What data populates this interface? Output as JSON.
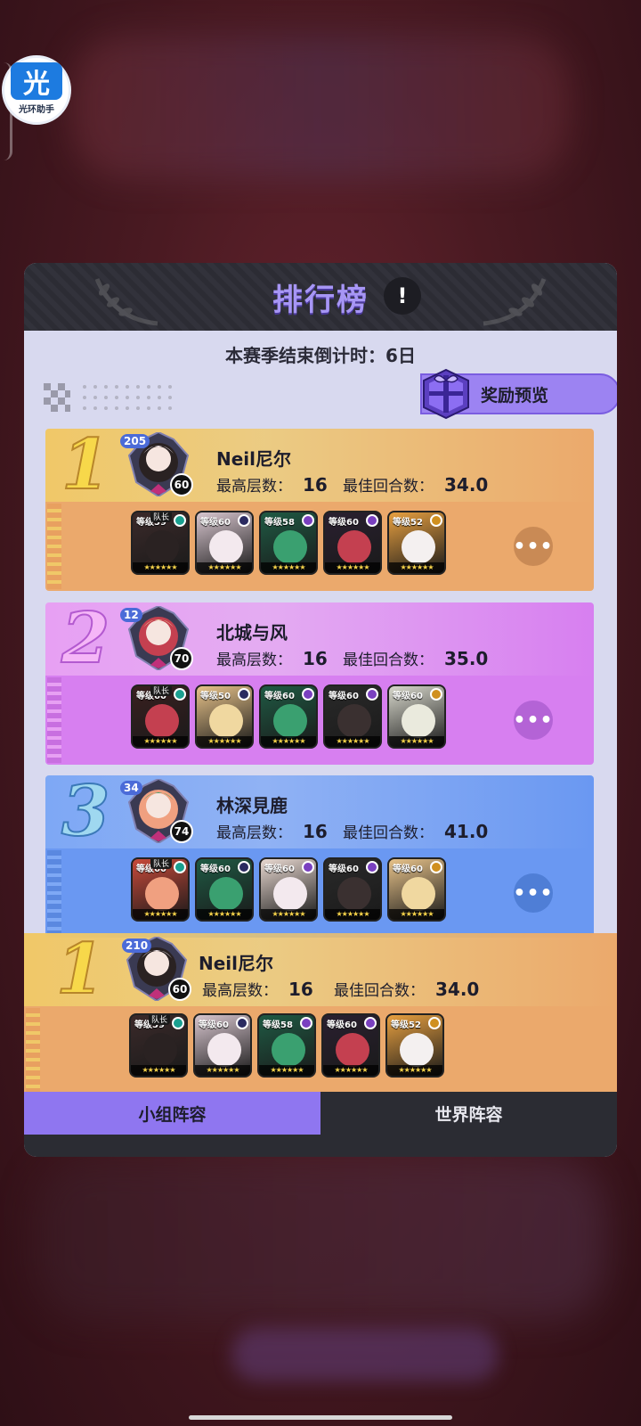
{
  "assistant": {
    "char": "光",
    "label": "光环助手"
  },
  "panel": {
    "title": "排行榜",
    "info_symbol": "!",
    "countdown_label": "本赛季结束倒计时：",
    "countdown_value": "6日",
    "reward_label": "奖励预览"
  },
  "labels": {
    "floor": "最高层数：",
    "round": "最佳回合数：",
    "more": "•••",
    "captain": "队长"
  },
  "ranks": [
    {
      "rank": "1",
      "name": "Neil尼尔",
      "badge": "205",
      "level": "60",
      "floor": "16",
      "round": "34.0",
      "heroes": [
        {
          "lvl": "等级59",
          "captain": true
        },
        {
          "lvl": "等级60"
        },
        {
          "lvl": "等级58"
        },
        {
          "lvl": "等级60"
        },
        {
          "lvl": "等级52"
        }
      ]
    },
    {
      "rank": "2",
      "name": "北城与风",
      "badge": "12",
      "level": "70",
      "floor": "16",
      "round": "35.0",
      "heroes": [
        {
          "lvl": "等级60",
          "captain": true
        },
        {
          "lvl": "等级50"
        },
        {
          "lvl": "等级60"
        },
        {
          "lvl": "等级60"
        },
        {
          "lvl": "等级60"
        }
      ]
    },
    {
      "rank": "3",
      "name": "林深見鹿",
      "badge": "34",
      "level": "74",
      "floor": "16",
      "round": "41.0",
      "heroes": [
        {
          "lvl": "等级60",
          "captain": true
        },
        {
          "lvl": "等级60"
        },
        {
          "lvl": "等级60"
        },
        {
          "lvl": "等级60"
        },
        {
          "lvl": "等级60"
        }
      ]
    }
  ],
  "own": {
    "rank": "1",
    "name": "Neil尼尔",
    "badge": "210",
    "level": "60",
    "floor": "16",
    "round": "34.0",
    "heroes": [
      {
        "lvl": "等级59",
        "captain": true
      },
      {
        "lvl": "等级60"
      },
      {
        "lvl": "等级58"
      },
      {
        "lvl": "等级60"
      },
      {
        "lvl": "等级52"
      }
    ]
  },
  "tabs": [
    {
      "label": "小组阵容",
      "active": true
    },
    {
      "label": "世界阵容",
      "active": false
    }
  ],
  "colors": {
    "gold_top": "#f0c868",
    "gold_bottom": "#eba96c",
    "pink_top": "#e7a0f3",
    "pink_bottom": "#d77ff0",
    "blue_top": "#7ea8f5",
    "blue_bottom": "#6a98f2",
    "accent": "#8f76f0"
  }
}
